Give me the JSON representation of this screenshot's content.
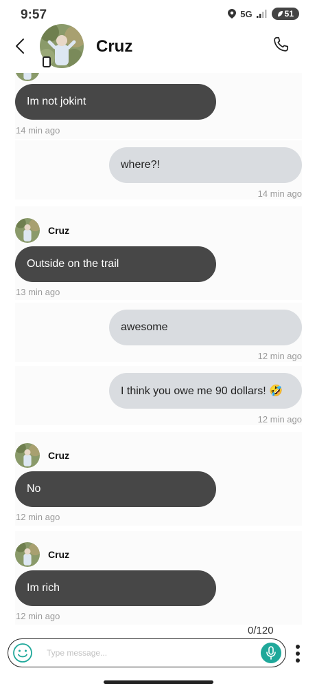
{
  "status_bar": {
    "time": "9:57",
    "network": "5G",
    "battery": "51"
  },
  "header": {
    "contact_name": "Cruz"
  },
  "messages": [
    {
      "direction": "incoming",
      "sender": "",
      "text": "Im not jokint",
      "time": "14 min ago"
    },
    {
      "direction": "outgoing",
      "sender": "",
      "text": "where?!",
      "time": "14 min ago"
    },
    {
      "direction": "incoming",
      "sender": "Cruz",
      "text": "Outside on the trail",
      "time": "13 min ago"
    },
    {
      "direction": "outgoing",
      "sender": "",
      "text": "awesome",
      "time": "12 min ago"
    },
    {
      "direction": "outgoing",
      "sender": "",
      "text": "I think you owe me 90 dollars! 🤣",
      "time": "12 min ago"
    },
    {
      "direction": "incoming",
      "sender": "Cruz",
      "text": "No",
      "time": "12 min ago"
    },
    {
      "direction": "incoming",
      "sender": "Cruz",
      "text": "Im rich",
      "time": "12 min ago"
    }
  ],
  "composer": {
    "char_count": "0/120",
    "placeholder": "Type message..."
  },
  "colors": {
    "incoming_bubble": "#474747",
    "outgoing_bubble": "#d9dce0",
    "mic_accent": "#1fa89a",
    "emoji_accent": "#1fa89a"
  },
  "icons": [
    "back-icon",
    "avatar",
    "watch-icon",
    "phone-icon",
    "emoji-icon",
    "mic-icon",
    "more-vertical-icon"
  ]
}
